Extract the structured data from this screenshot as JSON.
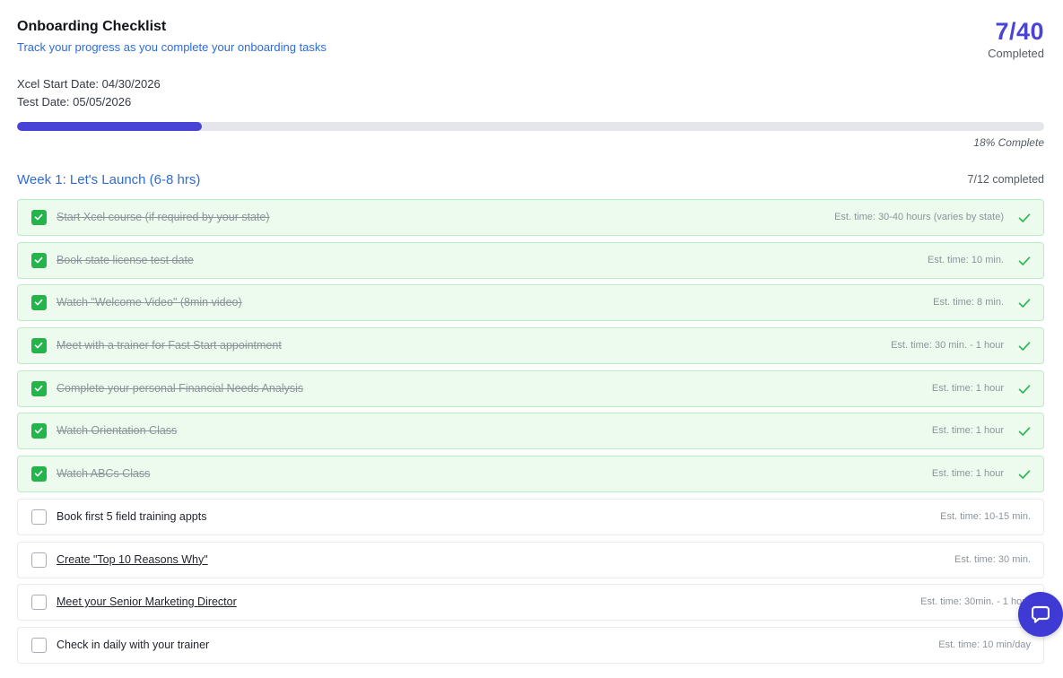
{
  "header": {
    "title": "Onboarding Checklist",
    "subtitle": "Track your progress as you complete your onboarding tasks",
    "start_date": "Xcel Start Date: 04/30/2026",
    "test_date": "Test Date: 05/05/2026"
  },
  "counter": {
    "value": "7/40",
    "label": "Completed"
  },
  "progress": {
    "percent": 18,
    "label": "18% Complete"
  },
  "week": {
    "title": "Week 1: Let's Launch (6-8 hrs)",
    "count": "7/12 completed"
  },
  "tasks": [
    {
      "label": "Start Xcel course (if required by your state)",
      "est": "Est. time: 30-40 hours (varies by state)",
      "done": true,
      "link": false
    },
    {
      "label": "Book state license test date",
      "est": "Est. time: 10 min.",
      "done": true,
      "link": false
    },
    {
      "label": "Watch \"Welcome Video\" (8min video)",
      "est": "Est. time: 8 min.",
      "done": true,
      "link": false
    },
    {
      "label": "Meet with a trainer for Fast Start appointment",
      "est": "Est. time: 30 min. - 1 hour",
      "done": true,
      "link": false
    },
    {
      "label": "Complete your personal Financial Needs Analysis",
      "est": "Est. time: 1 hour",
      "done": true,
      "link": false
    },
    {
      "label": "Watch Orientation Class",
      "est": "Est. time: 1 hour",
      "done": true,
      "link": false
    },
    {
      "label": "Watch ABCs Class",
      "est": "Est. time: 1 hour",
      "done": true,
      "link": false
    },
    {
      "label": "Book first 5 field training appts",
      "est": "Est. time: 10-15 min.",
      "done": false,
      "link": false
    },
    {
      "label": "Create \"Top 10 Reasons Why\"",
      "est": "Est. time: 30 min.",
      "done": false,
      "link": true
    },
    {
      "label": "Meet your Senior Marketing Director",
      "est": "Est. time: 30min. - 1 hour",
      "done": false,
      "link": true
    },
    {
      "label": "Check in daily with your trainer",
      "est": "Est. time: 10 min/day",
      "done": false,
      "link": false
    }
  ],
  "icons": {
    "checkbox_checked": "check-icon",
    "row_done": "check-icon",
    "chat": "chat-bubble-icon"
  },
  "colors": {
    "accent": "#4a44d6",
    "link": "#2e6bd8",
    "success": "#23b54c",
    "done_row_bg": "#edfbef"
  }
}
